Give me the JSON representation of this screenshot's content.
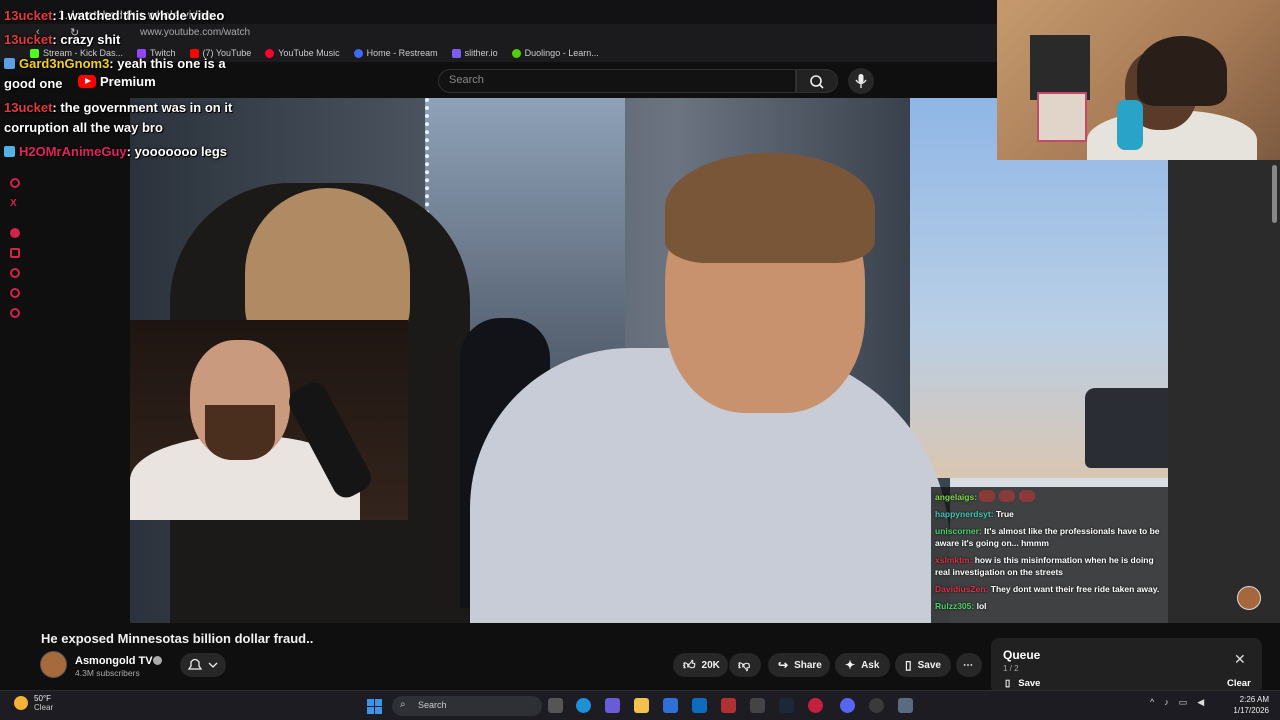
{
  "browser": {
    "tab_title": "1. I watched this whole video",
    "url": "www.youtube.com/watch",
    "bookmarks": [
      {
        "label": "Stream - Kick Das...",
        "color": "#53fc18"
      },
      {
        "label": "Twitch",
        "color": "#9146ff"
      },
      {
        "label": "(7) YouTube",
        "color": "#ff0000"
      },
      {
        "label": "YouTube Music",
        "color": "#ff0033"
      },
      {
        "label": "Home - Restream",
        "color": "#3b6cf6"
      },
      {
        "label": "slither.io",
        "color": "#7a5cff"
      },
      {
        "label": "Duolingo - Learn...",
        "color": "#58cc02"
      }
    ]
  },
  "youtube": {
    "logo_text": "Premium",
    "search_placeholder": "Search"
  },
  "overlay_chat": [
    {
      "user": "13ucket",
      "msg": ": I watched this whole video",
      "user_color": "#e03a3a",
      "badge_color": ""
    },
    {
      "user": "13ucket",
      "msg": ": crazy shit",
      "user_color": "#e03a3a",
      "badge_color": ""
    },
    {
      "user": "Gard3nGnom3",
      "msg": ": yeah this one is a",
      "user_color": "#f2d01e",
      "badge_color": "#5aa0e6"
    },
    {
      "user": "",
      "msg": "good one",
      "user_color": "#ffffff",
      "badge_color": ""
    },
    {
      "user": "13ucket",
      "msg": ": the government was in on it",
      "user_color": "#e03a3a",
      "badge_color": ""
    },
    {
      "user": "",
      "msg": "corruption all the way bro",
      "user_color": "#ffffff",
      "badge_color": ""
    },
    {
      "user": "H2OMrAnimeGuy",
      "msg": ": yooooooo legs",
      "user_color": "#e0245e",
      "badge_color": "#4fb3e8"
    }
  ],
  "stream_chat": [
    {
      "user": "angelaigs:",
      "msg": "",
      "user_color": "#7fd94a",
      "emotes": 3
    },
    {
      "user": "happynerdsyt:",
      "msg": "True",
      "user_color": "#3fc7b5",
      "emotes": 0
    },
    {
      "user": "uniscorner:",
      "msg": "It's almost like the professionals have to be aware it's going on... hmmm",
      "user_color": "#4bd16a",
      "emotes": 0
    },
    {
      "user": "xslmktm:",
      "msg": "how is this misinformation when he is doing real investigation on the streets",
      "user_color": "#d8304a",
      "emotes": 0
    },
    {
      "user": "DavidiusZen:",
      "msg": "They dont want their free ride taken away.",
      "user_color": "#d8304a",
      "emotes": 0
    },
    {
      "user": "Rulzz305:",
      "msg": "lol",
      "user_color": "#4bd16a",
      "emotes": 0
    }
  ],
  "video": {
    "title": "He exposed Minnesotas billion dollar fraud..",
    "channel": "Asmongold TV",
    "subscribers": "4.3M subscribers",
    "likes": "20K",
    "share_label": "Share",
    "ask_label": "Ask",
    "save_label": "Save",
    "more_label": "⋯"
  },
  "queue": {
    "title": "Queue",
    "count": "1 / 2",
    "save_label": "Save",
    "clear_label": "Clear"
  },
  "taskbar": {
    "temperature": "50°F",
    "condition": "Clear",
    "search_label": "Search",
    "time": "2:26 AM",
    "date": "1/17/2026"
  }
}
